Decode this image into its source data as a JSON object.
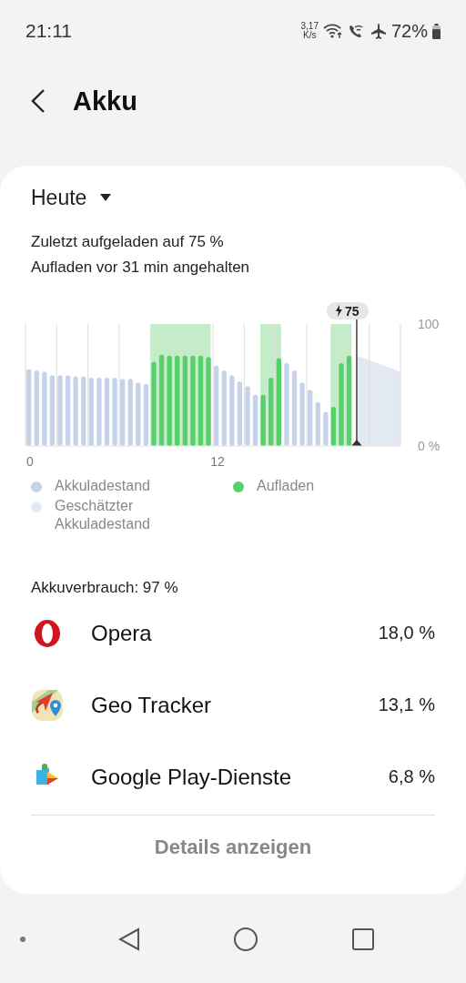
{
  "status_bar": {
    "time": "21:11",
    "speed_value": "3,17",
    "speed_unit": "K/s",
    "battery": "72%"
  },
  "header": {
    "title": "Akku"
  },
  "period": {
    "label": "Heute"
  },
  "info": [
    "Zuletzt aufgeladen auf 75 %",
    "Aufladen vor 31 min angehalten"
  ],
  "chart_data": {
    "type": "bar",
    "legend": "bottom",
    "x": [
      0,
      0.5,
      1,
      1.5,
      2,
      2.5,
      3,
      3.5,
      4,
      4.5,
      5,
      5.5,
      6,
      6.5,
      7,
      7.5,
      8,
      8.5,
      9,
      9.5,
      10,
      10.5,
      11,
      11.5,
      12,
      12.5,
      13,
      13.5,
      14,
      14.5,
      15,
      15.5,
      16,
      16.5,
      17,
      17.5,
      18,
      18.5,
      19,
      19.5,
      20,
      20.5
    ],
    "series": [
      {
        "name": "Akkuladestand",
        "color": "#c5d3e8",
        "values": [
          63,
          62,
          61,
          58,
          58,
          58,
          57,
          57,
          56,
          56,
          56,
          56,
          55,
          55,
          52,
          51,
          null,
          null,
          null,
          null,
          null,
          null,
          null,
          null,
          66,
          62,
          58,
          53,
          49,
          42,
          null,
          null,
          null,
          68,
          62,
          52,
          46,
          36,
          28,
          null,
          null,
          null
        ]
      },
      {
        "name": "Aufladen",
        "color": "#57cf6a",
        "values": [
          null,
          null,
          null,
          null,
          null,
          null,
          null,
          null,
          null,
          null,
          null,
          null,
          null,
          null,
          null,
          null,
          69,
          75,
          74,
          74,
          74,
          74,
          74,
          73,
          null,
          null,
          null,
          null,
          null,
          null,
          42,
          56,
          72,
          null,
          null,
          null,
          null,
          null,
          null,
          32,
          68,
          74
        ]
      }
    ],
    "xlim": [
      0,
      24
    ],
    "ylim": [
      0,
      100
    ],
    "xticks": [
      0,
      12
    ],
    "yticks": [
      {
        "value": 0,
        "label": "0 %"
      },
      {
        "value": 100,
        "label": "100"
      }
    ]
  },
  "now_badge": {
    "label": "75"
  },
  "estimate_legend": {
    "label": "Geschätzter Akkuladestand",
    "color": "#e3e9f2"
  },
  "usage": {
    "label": "Akkuverbrauch: 97 %"
  },
  "apps": [
    {
      "kind": "opera",
      "name": "Opera",
      "percent": "18,0 %"
    },
    {
      "kind": "geo",
      "name": "Geo Tracker",
      "percent": "13,1 %"
    },
    {
      "kind": "play",
      "name": "Google Play-Dienste",
      "percent": "6,8 %"
    }
  ],
  "details_button": "Details anzeigen"
}
